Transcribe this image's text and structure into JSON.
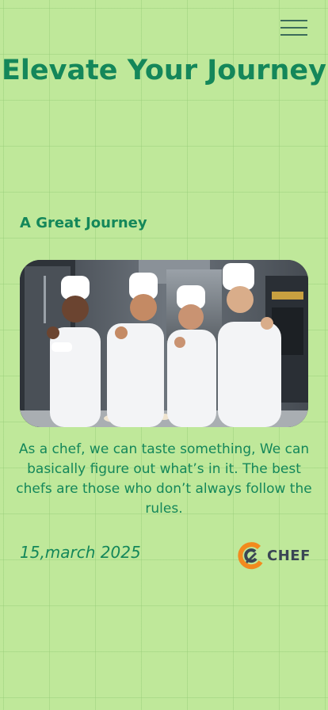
{
  "header": {
    "title": "Elevate Your Journey"
  },
  "section": {
    "heading": "A Great Journey"
  },
  "quote": "As a chef, we can taste something, We can basically figure out what’s in it. The best chefs are those who don’t always follow the rules.",
  "post": {
    "date": "15,march 2025"
  },
  "brand": {
    "name": "CHEF",
    "icon": "chef-logo-icon"
  },
  "menu": {
    "icon": "hamburger-menu-icon"
  },
  "colors": {
    "background": "#bfe89a",
    "accent": "#14875a",
    "brand_text": "#3a4654",
    "logo_orange": "#f28a1e"
  }
}
